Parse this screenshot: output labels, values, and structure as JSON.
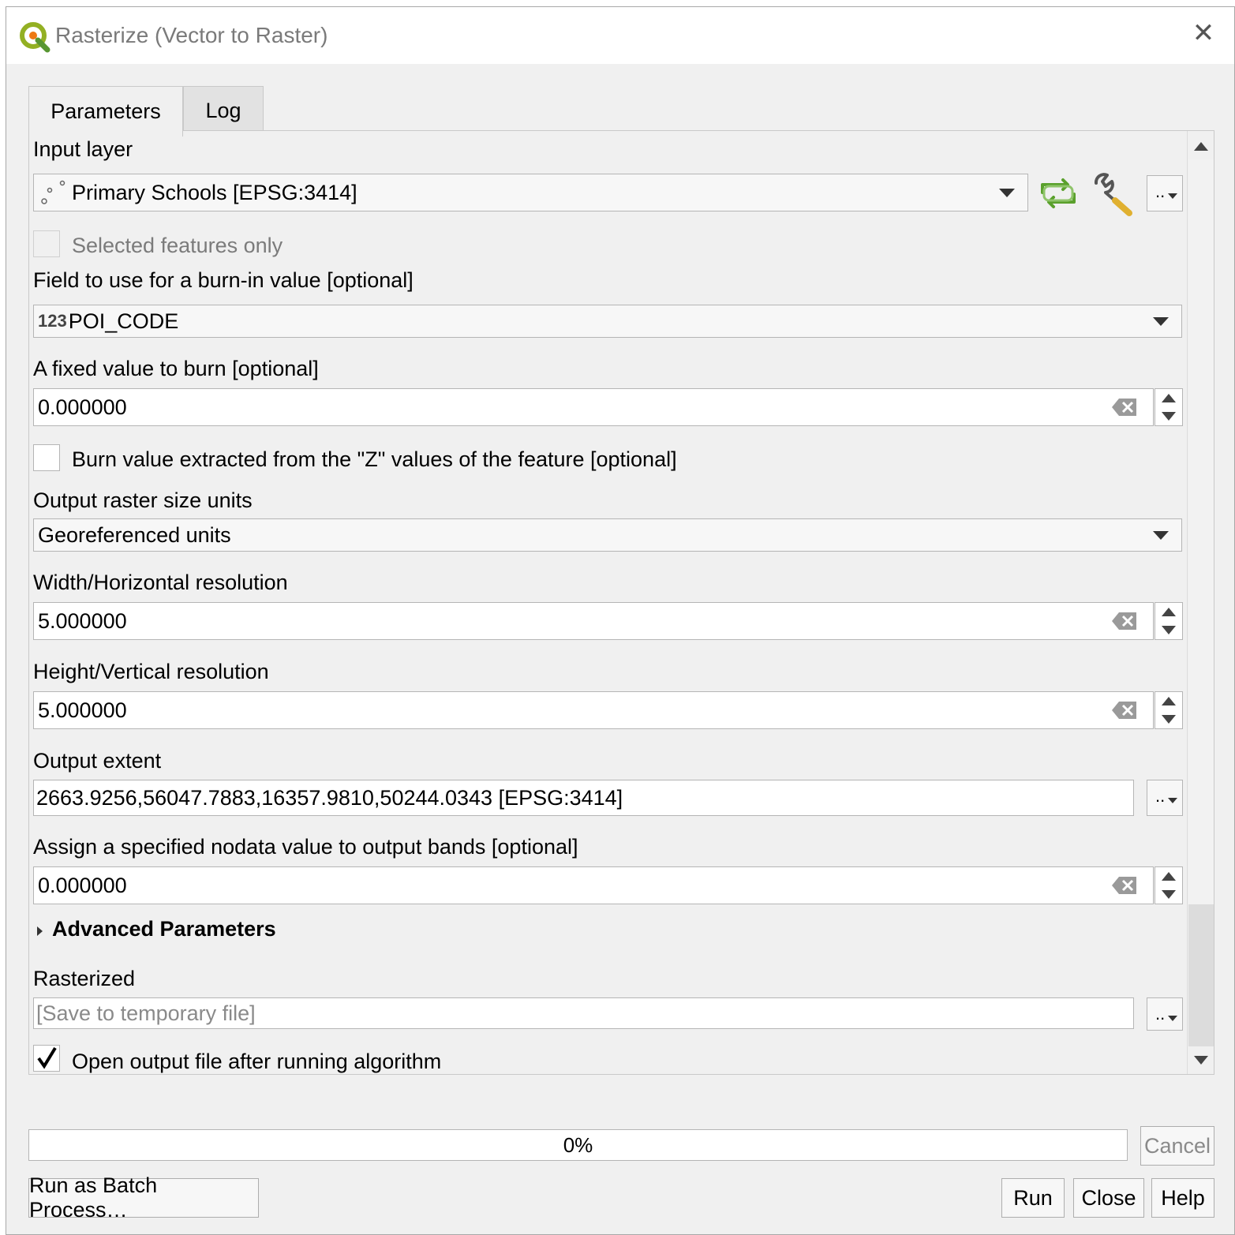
{
  "window": {
    "title": "Rasterize (Vector to Raster)",
    "close_icon": "close-icon",
    "app_icon": "qgis-logo-icon"
  },
  "tabs": [
    {
      "label": "Parameters",
      "active": true
    },
    {
      "label": "Log",
      "active": false
    }
  ],
  "params": {
    "input_layer": {
      "label": "Input layer",
      "value": "Primary Schools [EPSG:3414]",
      "icon": "point-layer-icon",
      "selected_only_label": "Selected features only",
      "selected_only_checked": false
    },
    "burn_field": {
      "label": "Field to use for a burn-in value [optional]",
      "type_badge": "123",
      "value": "POI_CODE"
    },
    "fixed_value": {
      "label": "A fixed value to burn [optional]",
      "value": "0.000000"
    },
    "burn_z": {
      "label": "Burn value extracted from the \"Z\" values of the feature [optional]",
      "checked": false
    },
    "size_units": {
      "label": "Output raster size units",
      "value": "Georeferenced units"
    },
    "width_res": {
      "label": "Width/Horizontal resolution",
      "value": "5.000000"
    },
    "height_res": {
      "label": "Height/Vertical resolution",
      "value": "5.000000"
    },
    "extent": {
      "label": "Output extent",
      "value": "2663.9256,56047.7883,16357.9810,50244.0343 [EPSG:3414]"
    },
    "nodata": {
      "label": "Assign a specified nodata value to output bands [optional]",
      "value": "0.000000"
    },
    "advanced_label": "Advanced Parameters",
    "output": {
      "label": "Rasterized",
      "placeholder": "[Save to temporary file]"
    },
    "open_after": {
      "label": "Open output file after running algorithm",
      "checked": true
    },
    "dots_label": ".."
  },
  "progress": {
    "percent": 0,
    "text": "0%"
  },
  "buttons": {
    "cancel": "Cancel",
    "batch": "Run as Batch Process…",
    "run": "Run",
    "close": "Close",
    "help": "Help"
  },
  "colors": {
    "accent_green": "#5aa02c",
    "progress_fill": "#3daee9",
    "window_bg": "#f0f0f0"
  }
}
